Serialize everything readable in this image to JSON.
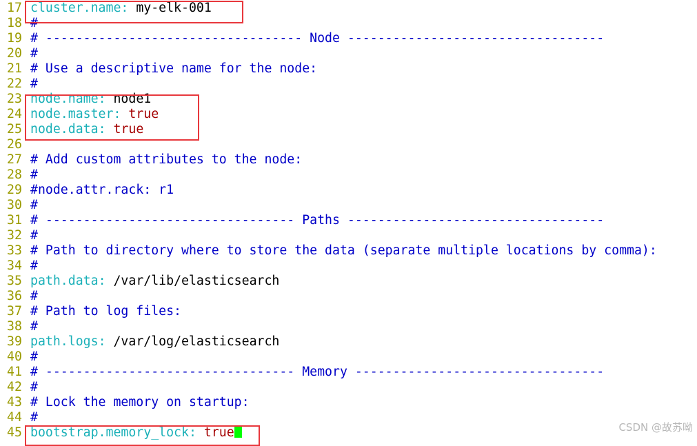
{
  "lines": [
    {
      "n": "17",
      "segments": [
        {
          "t": "cluster.name",
          "c": "key"
        },
        {
          "t": ": ",
          "c": "key"
        },
        {
          "t": "my-elk-001",
          "c": "plain"
        }
      ]
    },
    {
      "n": "18",
      "segments": [
        {
          "t": "#",
          "c": "comment"
        }
      ]
    },
    {
      "n": "19",
      "segments": [
        {
          "t": "# ---------------------------------- Node ----------------------------------",
          "c": "comment"
        }
      ]
    },
    {
      "n": "20",
      "segments": [
        {
          "t": "#",
          "c": "comment"
        }
      ]
    },
    {
      "n": "21",
      "segments": [
        {
          "t": "# Use a descriptive name for the node:",
          "c": "comment"
        }
      ]
    },
    {
      "n": "22",
      "segments": [
        {
          "t": "#",
          "c": "comment"
        }
      ]
    },
    {
      "n": "23",
      "segments": [
        {
          "t": "node.name",
          "c": "key"
        },
        {
          "t": ": ",
          "c": "key"
        },
        {
          "t": "node1",
          "c": "plain"
        }
      ]
    },
    {
      "n": "24",
      "segments": [
        {
          "t": "node.master",
          "c": "key"
        },
        {
          "t": ": ",
          "c": "key"
        },
        {
          "t": "true",
          "c": "bool"
        }
      ]
    },
    {
      "n": "25",
      "segments": [
        {
          "t": "node.data",
          "c": "key"
        },
        {
          "t": ": ",
          "c": "key"
        },
        {
          "t": "true",
          "c": "bool"
        }
      ]
    },
    {
      "n": "26",
      "segments": []
    },
    {
      "n": "27",
      "segments": [
        {
          "t": "# Add custom attributes to the node:",
          "c": "comment"
        }
      ]
    },
    {
      "n": "28",
      "segments": [
        {
          "t": "#",
          "c": "comment"
        }
      ]
    },
    {
      "n": "29",
      "segments": [
        {
          "t": "#node.attr.rack: r1",
          "c": "comment"
        }
      ]
    },
    {
      "n": "30",
      "segments": [
        {
          "t": "#",
          "c": "comment"
        }
      ]
    },
    {
      "n": "31",
      "segments": [
        {
          "t": "# --------------------------------- Paths ----------------------------------",
          "c": "comment"
        }
      ]
    },
    {
      "n": "32",
      "segments": [
        {
          "t": "#",
          "c": "comment"
        }
      ]
    },
    {
      "n": "33",
      "segments": [
        {
          "t": "# Path to directory where to store the data (separate multiple locations by comma):",
          "c": "comment"
        }
      ]
    },
    {
      "n": "34",
      "segments": [
        {
          "t": "#",
          "c": "comment"
        }
      ]
    },
    {
      "n": "35",
      "segments": [
        {
          "t": "path.data",
          "c": "key"
        },
        {
          "t": ": ",
          "c": "key"
        },
        {
          "t": "/var/lib/elasticsearch",
          "c": "plain"
        }
      ]
    },
    {
      "n": "36",
      "segments": [
        {
          "t": "#",
          "c": "comment"
        }
      ]
    },
    {
      "n": "37",
      "segments": [
        {
          "t": "# Path to log files:",
          "c": "comment"
        }
      ]
    },
    {
      "n": "38",
      "segments": [
        {
          "t": "#",
          "c": "comment"
        }
      ]
    },
    {
      "n": "39",
      "segments": [
        {
          "t": "path.logs",
          "c": "key"
        },
        {
          "t": ": ",
          "c": "key"
        },
        {
          "t": "/var/log/elasticsearch",
          "c": "plain"
        }
      ]
    },
    {
      "n": "40",
      "segments": [
        {
          "t": "#",
          "c": "comment"
        }
      ]
    },
    {
      "n": "41",
      "segments": [
        {
          "t": "# --------------------------------- Memory ---------------------------------",
          "c": "comment"
        }
      ]
    },
    {
      "n": "42",
      "segments": [
        {
          "t": "#",
          "c": "comment"
        }
      ]
    },
    {
      "n": "43",
      "segments": [
        {
          "t": "# Lock the memory on startup:",
          "c": "comment"
        }
      ]
    },
    {
      "n": "44",
      "segments": [
        {
          "t": "#",
          "c": "comment"
        }
      ]
    },
    {
      "n": "45",
      "segments": [
        {
          "t": "bootstrap.memory_lock",
          "c": "key"
        },
        {
          "t": ": ",
          "c": "key"
        },
        {
          "t": "true",
          "c": "bool"
        }
      ],
      "cursor": true
    }
  ],
  "colors": {
    "line_number": "#9b9b00",
    "comment": "#0000c8",
    "key": "#1ab0b8",
    "value_plain": "#000000",
    "value_bool": "#a40000",
    "cursor": "#00ff00",
    "highlight_box": "#e8383d"
  },
  "watermark": "CSDN @故苏呦"
}
